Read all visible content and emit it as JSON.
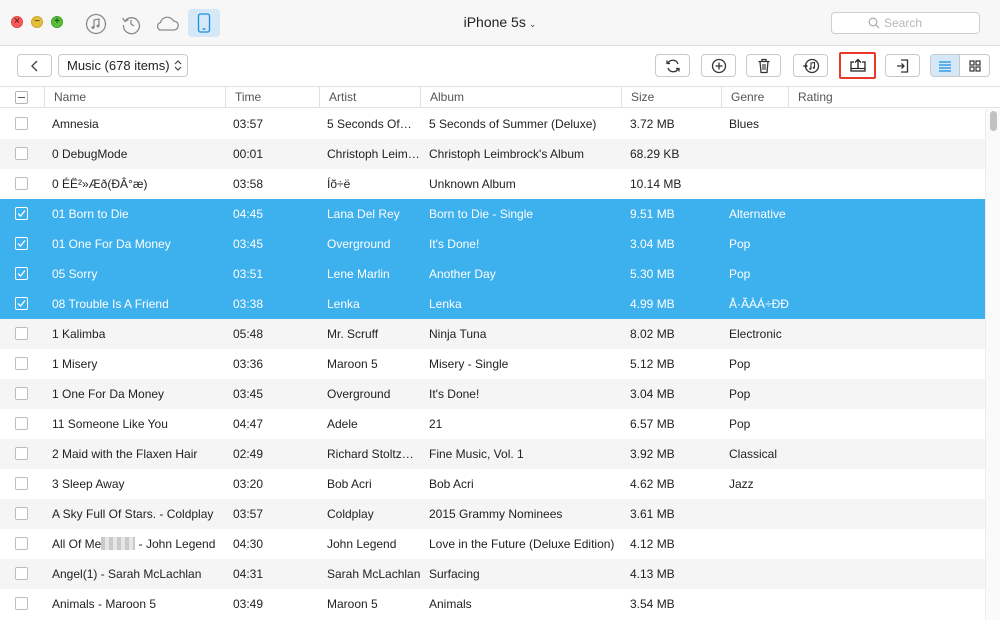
{
  "window": {
    "device_title": "iPhone 5s",
    "search_placeholder": "Search",
    "traffic": {
      "close": "×",
      "minimize": "−",
      "maximize": "+"
    }
  },
  "toolbar": {
    "category_label": "Music (678 items)"
  },
  "table": {
    "columns": {
      "name": "Name",
      "time": "Time",
      "artist": "Artist",
      "album": "Album",
      "size": "Size",
      "genre": "Genre",
      "rating": "Rating"
    },
    "rows": [
      {
        "name": "Amnesia",
        "time": "03:57",
        "artist": "5 Seconds Of…",
        "album": "5 Seconds of Summer (Deluxe)",
        "size": "3.72 MB",
        "genre": "Blues",
        "selected": false
      },
      {
        "name": "0 DebugMode",
        "time": "00:01",
        "artist": "Christoph Leim…",
        "album": "Christoph Leimbrock's Album",
        "size": "68.29 KB",
        "genre": "",
        "selected": false
      },
      {
        "name": "0 ÉË²»Æð(ÐÂ°æ)",
        "time": "03:58",
        "artist": "Íõ÷ë",
        "album": "Unknown Album",
        "size": "10.14 MB",
        "genre": "",
        "selected": false
      },
      {
        "name": "01 Born to Die",
        "time": "04:45",
        "artist": "Lana Del Rey",
        "album": "Born to Die - Single",
        "size": "9.51 MB",
        "genre": "Alternative",
        "selected": true
      },
      {
        "name": "01 One For Da Money",
        "time": "03:45",
        "artist": "Overground",
        "album": "It's Done!",
        "size": "3.04 MB",
        "genre": "Pop",
        "selected": true
      },
      {
        "name": "05 Sorry",
        "time": "03:51",
        "artist": "Lene Marlin",
        "album": "Another Day",
        "size": "5.30 MB",
        "genre": "Pop",
        "selected": true
      },
      {
        "name": "08 Trouble Is A Friend",
        "time": "03:38",
        "artist": "Lenka",
        "album": "Lenka",
        "size": "4.99 MB",
        "genre": "Å·ÃÀÁ÷ÐÐ",
        "selected": true
      },
      {
        "name": "1 Kalimba",
        "time": "05:48",
        "artist": "Mr. Scruff",
        "album": "Ninja Tuna",
        "size": "8.02 MB",
        "genre": "Electronic",
        "selected": false
      },
      {
        "name": "1 Misery",
        "time": "03:36",
        "artist": "Maroon 5",
        "album": "Misery - Single",
        "size": "5.12 MB",
        "genre": "Pop",
        "selected": false
      },
      {
        "name": "1 One For Da Money",
        "time": "03:45",
        "artist": "Overground",
        "album": "It's Done!",
        "size": "3.04 MB",
        "genre": "Pop",
        "selected": false
      },
      {
        "name": "11 Someone Like You",
        "time": "04:47",
        "artist": "Adele",
        "album": "21",
        "size": "6.57 MB",
        "genre": "Pop",
        "selected": false
      },
      {
        "name": "2 Maid with the Flaxen Hair",
        "time": "02:49",
        "artist": "Richard Stoltz…",
        "album": "Fine Music, Vol. 1",
        "size": "3.92 MB",
        "genre": "Classical",
        "selected": false
      },
      {
        "name": "3 Sleep Away",
        "time": "03:20",
        "artist": "Bob Acri",
        "album": "Bob Acri",
        "size": "4.62 MB",
        "genre": "Jazz",
        "selected": false
      },
      {
        "name": "A Sky Full Of Stars. - Coldplay",
        "time": "03:57",
        "artist": "Coldplay",
        "album": "2015 Grammy Nominees",
        "size": "3.61 MB",
        "genre": "",
        "selected": false
      },
      {
        "name_prefix": "All Of Me",
        "name_suffix": " - John Legend",
        "time": "04:30",
        "artist": "John Legend",
        "album": "Love in the Future (Deluxe Edition)",
        "size": "4.12 MB",
        "genre": "",
        "selected": false
      },
      {
        "name": "Angel(1) - Sarah McLachlan",
        "time": "04:31",
        "artist": "Sarah McLachlan",
        "album": "Surfacing",
        "size": "4.13 MB",
        "genre": "",
        "selected": false
      },
      {
        "name": "Animals - Maroon 5",
        "time": "03:49",
        "artist": "Maroon 5",
        "album": "Animals",
        "size": "3.54 MB",
        "genre": "",
        "selected": false
      }
    ]
  },
  "colors": {
    "selection": "#3db0ee",
    "accent": "#1a8fe0",
    "highlight_border": "#e8392b",
    "active_tab_bg": "#d4e8f8"
  },
  "icons": {
    "top": [
      "music-note-icon",
      "restore-icon",
      "icloud-icon",
      "phone-icon"
    ],
    "toolbar": [
      "back-arrow-icon",
      "refresh-icon",
      "add-icon",
      "delete-icon",
      "to-itunes-icon",
      "export-to-computer-icon",
      "import-icon",
      "list-view-icon",
      "grid-view-icon"
    ]
  }
}
